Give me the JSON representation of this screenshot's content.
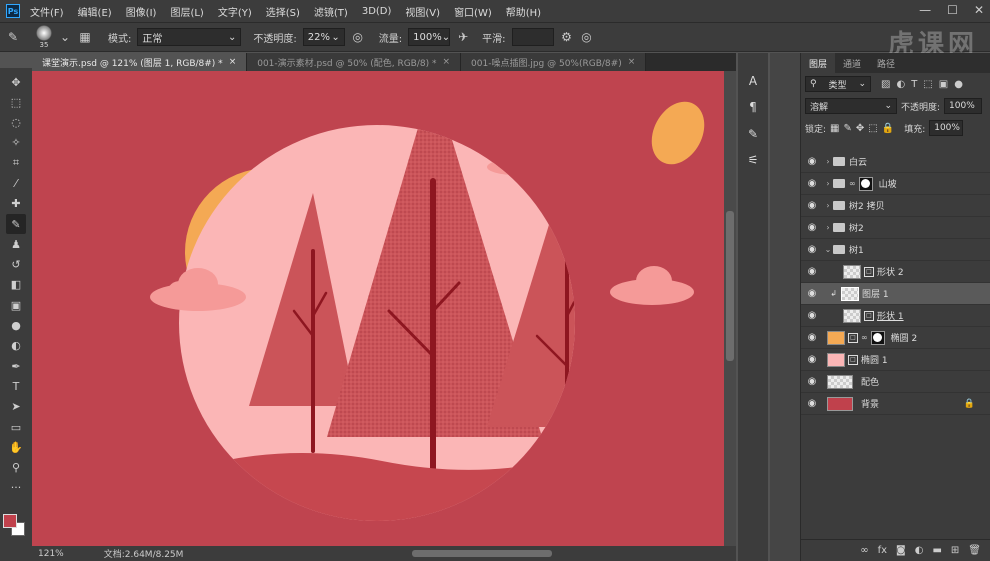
{
  "menu": {
    "logo": "Ps",
    "items": [
      "文件(F)",
      "编辑(E)",
      "图像(I)",
      "图层(L)",
      "文字(Y)",
      "选择(S)",
      "滤镜(T)",
      "3D(D)",
      "视图(V)",
      "窗口(W)",
      "帮助(H)"
    ]
  },
  "options": {
    "brush_size": "35",
    "mode_label": "模式:",
    "mode_value": "正常",
    "opacity_label": "不透明度:",
    "opacity_value": "22%",
    "flow_label": "流量:",
    "flow_value": "100%",
    "smooth_label": "平滑:",
    "smooth_value": ""
  },
  "watermark": "虎课网",
  "tabs": [
    {
      "label": "课堂演示.psd @ 121% (图层 1, RGB/8#) *",
      "active": true
    },
    {
      "label": "001-演示素材.psd @ 50% (配色, RGB/8) *",
      "active": false
    },
    {
      "label": "001-噪点插图.jpg @ 50%(RGB/8#)",
      "active": false
    }
  ],
  "status": {
    "zoom": "121%",
    "doc": "文档:2.64M/8.25M"
  },
  "panel": {
    "tabs": [
      "图层",
      "通道",
      "路径"
    ],
    "filter_kind": "类型",
    "blend_mode": "溶解",
    "opacity_label": "不透明度:",
    "opacity_value": "100%",
    "lock_label": "锁定:",
    "fill_label": "填充:",
    "fill_value": "100%",
    "layers": [
      {
        "name": "白云"
      },
      {
        "name": "山坡"
      },
      {
        "name": "树2 拷贝"
      },
      {
        "name": "树2"
      },
      {
        "name": "树1"
      },
      {
        "name": "形状 2"
      },
      {
        "name": "图层 1"
      },
      {
        "name": "形状 1"
      },
      {
        "name": "椭圆 2"
      },
      {
        "name": "椭圆 1"
      },
      {
        "name": "配色"
      },
      {
        "name": "背景"
      }
    ]
  },
  "colors": {
    "canvas_bg": "#bf444f",
    "sun": "#f4a954",
    "circle": "#fbb6b6",
    "tree": "#cb5459",
    "trunk": "#8e1620",
    "cloud": "#f59a98",
    "hill": "#c6474f",
    "fg_swatch": "#c0414c"
  }
}
